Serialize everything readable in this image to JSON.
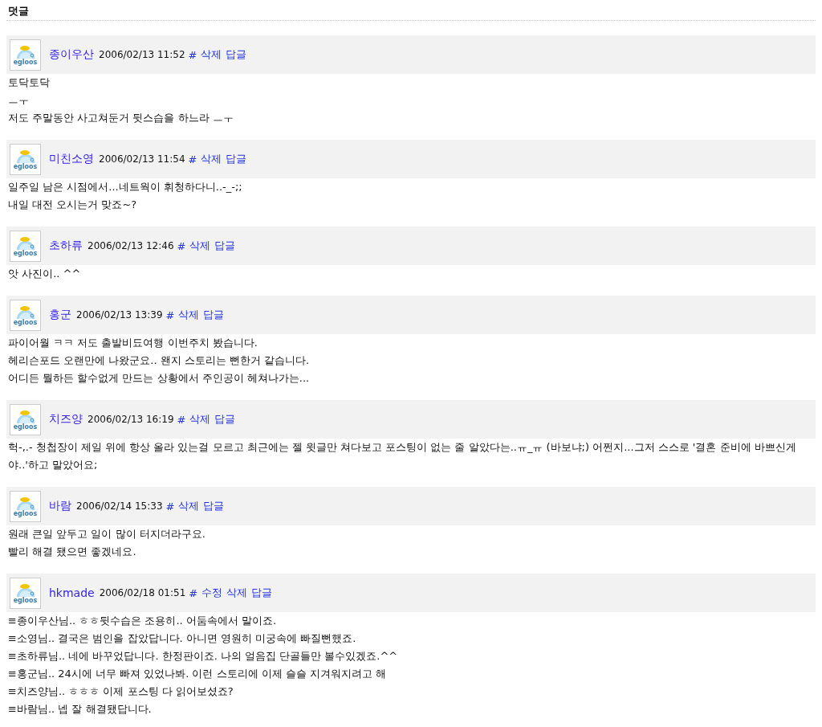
{
  "section_title": "덧글",
  "comments": [
    {
      "avatar_label": "egloos",
      "author": "종이우산",
      "date": "2006/02/13 11:52",
      "actions": [
        "#",
        "삭제",
        "답글"
      ],
      "lines": [
        "토닥토닥",
        "ㅡㅜ",
        "저도 주말동안 사고쳐둔거 뒷스습을 하느라 ㅡㅜ"
      ]
    },
    {
      "avatar_label": "egloos",
      "author": "미친소영",
      "date": "2006/02/13 11:54",
      "actions": [
        "#",
        "삭제",
        "답글"
      ],
      "lines": [
        "일주일 남은 시점에서...네트웍이 휘청하다니..-_-;;",
        "내일 대전 오시는거 맞죠~?"
      ]
    },
    {
      "avatar_label": "egloos",
      "author": "초하류",
      "date": "2006/02/13 12:46",
      "actions": [
        "#",
        "삭제",
        "답글"
      ],
      "lines": [
        "앗 사진이.. ^^"
      ]
    },
    {
      "avatar_label": "egloos",
      "author": "홍군",
      "date": "2006/02/13 13:39",
      "actions": [
        "#",
        "삭제",
        "답글"
      ],
      "lines": [
        "파이어월 ㅋㅋ 저도 출발비됴여행 이번주치 봤습니다.",
        "헤리슨포드 오랜만에 나왔군요.. 왠지 스토리는 뻔한거 같습니다.",
        "어디든 뭘하든 할수없게 만드는 상황에서 주인공이 헤쳐나가는..."
      ]
    },
    {
      "avatar_label": "egloos",
      "author": "치즈양",
      "date": "2006/02/13 16:19",
      "actions": [
        "#",
        "삭제",
        "답글"
      ],
      "lines": [
        "헉-,.- 청첩장이 제일 위에 항상 올라 있는걸 모르고 최근에는 젤 윗글만 쳐다보고 포스팅이 없는 줄 알았다는..ㅠ_ㅠ (바보냐;) 어쩐지...그저 스스로 '결혼 준비에 바쁘신게야..'하고 말았어요;"
      ]
    },
    {
      "avatar_label": "egloos",
      "author": "바람",
      "date": "2006/02/14 15:33",
      "actions": [
        "#",
        "삭제",
        "답글"
      ],
      "lines": [
        "원래 큰일 앞두고 일이 많이 터지더라구요.",
        "빨리 해결 됐으면 좋겠네요."
      ]
    },
    {
      "avatar_label": "egloos",
      "author": "hkmade",
      "date": "2006/02/18 01:51",
      "actions": [
        "#",
        "수정",
        "삭제",
        "답글"
      ],
      "lines": [
        "≡종이우산님.. ㅎㅎ뒷수습은 조용히.. 어둠속에서 말이죠.",
        "≡소영님.. 결국은 범인을 잡았답니다. 아니면 영원히 미궁속에 빠질뻔했죠.",
        "≡초하류님.. 네에 바꾸었답니다. 한정판이죠. 나의 얼음집 단골들만 볼수있겠죠.^^",
        "≡홍군님.. 24시에 너무 빠져 있었나봐. 이런 스토리에 이제 슬슬 지겨워지려고 해",
        "≡치즈양님.. ㅎㅎㅎ 이제 포스팅 다 읽어보셨죠?",
        "≡바람님.. 넵 잘 해결됐답니다."
      ]
    }
  ]
}
